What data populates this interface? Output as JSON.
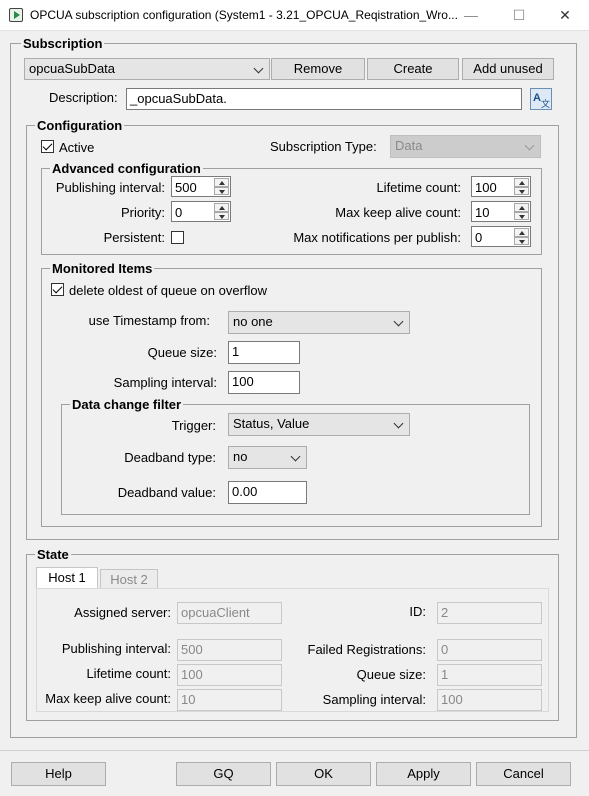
{
  "window": {
    "title": "OPCUA subscription configuration (System1 - 3.21_OPCUA_Reqistration_Wro...",
    "minimize": "—",
    "maximize": "☐",
    "close": "✕"
  },
  "subscription": {
    "group_title": "Subscription",
    "selected": "opcuaSubData",
    "remove_label": "Remove",
    "create_label": "Create",
    "add_unused_label": "Add unused",
    "description_label": "Description:",
    "description_value": "_opcuaSubData."
  },
  "configuration": {
    "group_title": "Configuration",
    "active_label": "Active",
    "active_checked": true,
    "subscription_type_label": "Subscription Type:",
    "subscription_type_value": "Data",
    "advanced": {
      "group_title": "Advanced configuration",
      "publishing_interval_label": "Publishing interval:",
      "publishing_interval_value": "500",
      "priority_label": "Priority:",
      "priority_value": "0",
      "persistent_label": "Persistent:",
      "persistent_checked": false,
      "lifetime_count_label": "Lifetime count:",
      "lifetime_count_value": "100",
      "max_keep_alive_label": "Max keep alive count:",
      "max_keep_alive_value": "10",
      "max_notifications_label": "Max notifications per publish:",
      "max_notifications_value": "0"
    },
    "monitored": {
      "group_title": "Monitored Items",
      "delete_oldest_label": "delete oldest of queue on overflow",
      "delete_oldest_checked": true,
      "timestamp_label": "use Timestamp from:",
      "timestamp_value": "no one",
      "queue_size_label": "Queue size:",
      "queue_size_value": "1",
      "sampling_interval_label": "Sampling interval:",
      "sampling_interval_value": "100",
      "filter": {
        "group_title": "Data change filter",
        "trigger_label": "Trigger:",
        "trigger_value": "Status, Value",
        "deadband_type_label": "Deadband type:",
        "deadband_type_value": "no",
        "deadband_value_label": "Deadband value:",
        "deadband_value_value": "0.00"
      }
    }
  },
  "state": {
    "group_title": "State",
    "tabs": [
      "Host 1",
      "Host 2"
    ],
    "assigned_server_label": "Assigned server:",
    "assigned_server_value": "opcuaClient",
    "id_label": "ID:",
    "id_value": "2",
    "publishing_interval_label": "Publishing interval:",
    "publishing_interval_value": "500",
    "failed_registrations_label": "Failed Registrations:",
    "failed_registrations_value": "0",
    "lifetime_count_label": "Lifetime count:",
    "lifetime_count_value": "100",
    "queue_size_label": "Queue size:",
    "queue_size_value": "1",
    "max_keep_alive_label": "Max keep alive count:",
    "max_keep_alive_value": "10",
    "sampling_interval_label": "Sampling interval:",
    "sampling_interval_value": "100"
  },
  "footer": {
    "help_label": "Help",
    "gq_label": "GQ",
    "ok_label": "OK",
    "apply_label": "Apply",
    "cancel_label": "Cancel"
  }
}
